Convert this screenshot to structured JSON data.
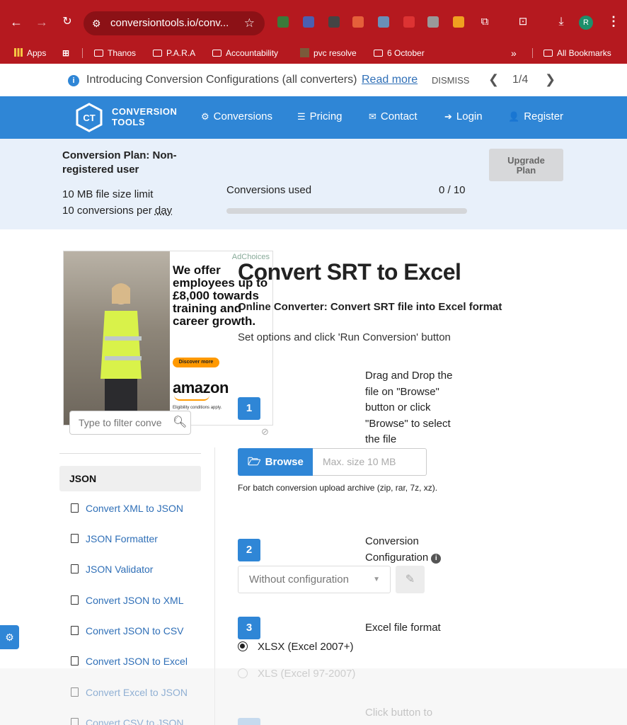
{
  "browser": {
    "url": "conversiontools.io/conv...",
    "bookmarks": [
      "Apps",
      "Thanos",
      "P.A.R.A",
      "Accountability",
      "pvc resolve",
      "6 October",
      "All Bookmarks"
    ],
    "overflow": "»",
    "profile_initial": "R"
  },
  "announcement": {
    "text": "Introducing Conversion Configurations (all converters)",
    "link": "Read more",
    "dismiss": "DISMISS",
    "pager": "1/4"
  },
  "header": {
    "logo_line1": "CONVERSION",
    "logo_line2": "TOOLS",
    "logo_mark": "CT",
    "nav": [
      "Conversions",
      "Pricing",
      "Contact",
      "Login",
      "Register"
    ]
  },
  "plan": {
    "title": "Conversion Plan: Non-registered user",
    "limit": "10 MB file size limit",
    "per_day_prefix": "10 conversions per ",
    "per_day_word": "day",
    "used_label": "Conversions used",
    "used_count": "0 / 10",
    "used_fraction": 0,
    "upgrade_line1": "Upgrade",
    "upgrade_line2": "Plan"
  },
  "ad": {
    "choices": "AdChoices",
    "headline": "We offer employees up to £8,000 towards training and career growth.",
    "cta": "Discover more",
    "brand": "amazon",
    "terms": "Eligibility conditions apply."
  },
  "sidebar": {
    "filter_placeholder": "Type to filter conve",
    "category": "JSON",
    "links": [
      "Convert XML to JSON",
      "JSON Formatter",
      "JSON Validator",
      "Convert JSON to XML",
      "Convert JSON to CSV",
      "Convert JSON to Excel",
      "Convert Excel to JSON",
      "Convert CSV to JSON"
    ]
  },
  "main": {
    "title": "Convert SRT to Excel",
    "subtitle": "Online Converter: Convert SRT file into Excel format",
    "instructions": "Set options and click 'Run Conversion' button",
    "step1": {
      "number": "1",
      "text": "Drag and Drop the file on \"Browse\" button or click \"Browse\" to select the file",
      "browse_label": "Browse",
      "size_placeholder": "Max. size 10 MB",
      "batch_note": "For batch conversion upload archive (zip, rar, 7z, xz)."
    },
    "step2": {
      "number": "2",
      "text": "Conversion Configuration",
      "select_value": "Without configuration"
    },
    "step3": {
      "number": "3",
      "text": "Excel file format",
      "options": [
        "XLSX (Excel 2007+)",
        "XLS (Excel 97-2007)"
      ],
      "selected": "XLSX (Excel 2007+)"
    },
    "step4": {
      "text": "Click button to"
    }
  },
  "colors": {
    "browser_red": "#b5191f",
    "brand_blue": "#2f86d6",
    "link_blue": "#2f6fb7",
    "plan_bg": "#e8f0fa"
  }
}
